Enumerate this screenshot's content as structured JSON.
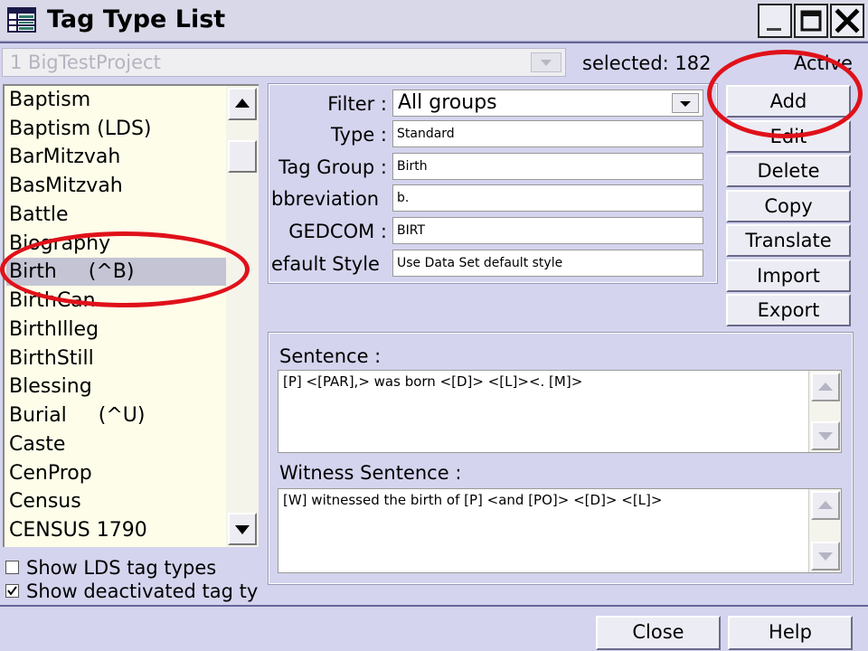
{
  "window": {
    "title": "Tag Type List",
    "icon": "grid-table-icon"
  },
  "project": {
    "value": "1 BigTestProject",
    "selected_label": "selected: 182",
    "active_label": "Active"
  },
  "tag_list": {
    "items": [
      "Baptism",
      "Baptism (LDS)",
      "BarMitzvah",
      "BasMitzvah",
      "Battle",
      "Biography",
      "Birth     (^B)",
      "BirthCan",
      "BirthIlleg",
      "BirthStill",
      "Blessing",
      "Burial     (^U)",
      "Caste",
      "CenProp",
      "Census",
      "CENSUS 1790"
    ],
    "selected": "Birth     (^B)"
  },
  "options": {
    "show_lds": "Show LDS tag types",
    "show_lds_checked": false,
    "show_deactivated": "Show deactivated tag type",
    "show_deactivated_checked": true
  },
  "details": {
    "filter_label": "Filter :",
    "filter_value": "All groups",
    "type_label": "Type :",
    "type_value": "Standard",
    "group_label": "Tag Group :",
    "group_value": "Birth",
    "abbrev_label": "bbreviation :",
    "abbrev_value": "b.",
    "gedcom_label": "GEDCOM :",
    "gedcom_value": "BIRT",
    "style_label": "efault Style :",
    "style_value": "Use Data Set default style"
  },
  "buttons": {
    "add": "Add",
    "edit": "Edit",
    "delete": "Delete",
    "copy": "Copy",
    "translate": "Translate",
    "import": "Import",
    "export": "Export",
    "close": "Close",
    "help": "Help"
  },
  "sentence": {
    "label": "Sentence :",
    "value": "[P] <[PAR],> was born <[D]> <[L]><.  [M]>"
  },
  "witness": {
    "label": "Witness Sentence :",
    "value": "[W] witnessed the birth of [P] <and [PO]> <[D]> <[L]>"
  },
  "annotation": {
    "color": "#e0111a"
  }
}
